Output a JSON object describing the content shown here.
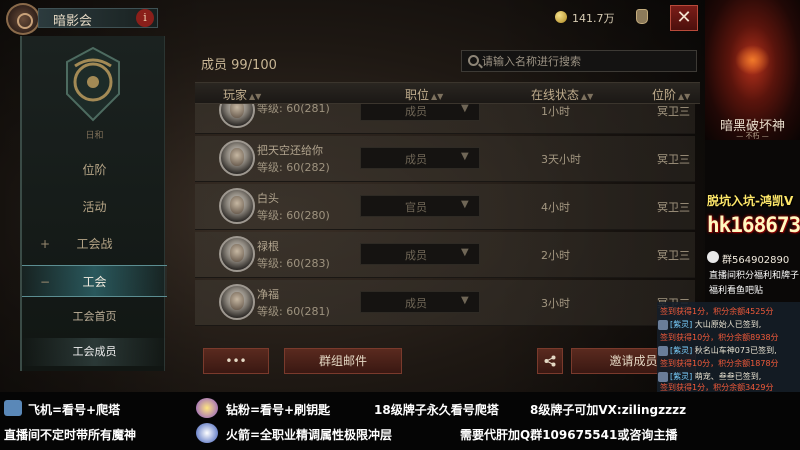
{
  "header": {
    "guild_title": "暗影会",
    "info_glyph": "i",
    "currency": "141.7万",
    "close_glyph": "✕"
  },
  "sidebar": {
    "emblem_caption": "日和",
    "items": [
      {
        "label": "位阶"
      },
      {
        "label": "活动"
      },
      {
        "label": "工会战",
        "mark": "+"
      },
      {
        "label": "工会",
        "mark": "−",
        "active": true
      }
    ],
    "subitems": [
      {
        "label": "工会首页"
      },
      {
        "label": "工会成员",
        "active": true
      }
    ]
  },
  "main": {
    "member_count": "成员 99/100",
    "search_placeholder": "请输入名称进行搜索",
    "columns": {
      "player": "玩家",
      "role": "职位",
      "status": "在线状态",
      "position": "位阶"
    },
    "sort_glyph": "▲▼",
    "rows": [
      {
        "name": "",
        "level": "等级: 60(281)",
        "role": "成员",
        "status": "1小时",
        "position": "冥卫三"
      },
      {
        "name": "把天空还给你",
        "level": "等级: 60(282)",
        "role": "成员",
        "status": "3天小时",
        "position": "冥卫三"
      },
      {
        "name": "白头",
        "level": "等级: 60(280)",
        "role": "官员",
        "status": "4小时",
        "position": "冥卫三"
      },
      {
        "name": "禄根",
        "level": "等级: 60(283)",
        "role": "成员",
        "status": "2小时",
        "position": "冥卫三"
      },
      {
        "name": "净福",
        "level": "等级: 60(281)",
        "role": "成员",
        "status": "3小时",
        "position": "冥卫三"
      }
    ],
    "dropdown_glyph": "▼",
    "buttons": {
      "more": "•••",
      "group_mail": "群组邮件",
      "invite": "邀请成员"
    }
  },
  "right_banner": {
    "logo": "暗黑破坏神",
    "logo_sub": "— 不朽 —",
    "promo_1": "脱坑入坑-鸿凯V",
    "promo_id": "hk168673",
    "qq_group": "群564902890",
    "promo_2": "直播间积分福利和牌子福利看鱼吧贴"
  },
  "chat": [
    {
      "text": "签到获得1分，积分余额4525分"
    },
    {
      "tag": "[紫灵]",
      "who": "大山原始人",
      "text": "已签到,"
    },
    {
      "text": "签到获得10分，积分余额8938分"
    },
    {
      "tag": "[紫灵]",
      "who": "秋名山车神073",
      "text": "已签到,"
    },
    {
      "text": "签到获得10分，积分余额1878分"
    },
    {
      "tag": "[紫灵]",
      "who": "萌宠、叁叁",
      "text": "已签到,"
    },
    {
      "text": "签到获得1分，积分余额3429分"
    }
  ],
  "bottom": {
    "line1a": "飞机=看号+爬塔",
    "line1b": "钻粉=看号+刷钥匙",
    "line1c": "18级牌子永久看号爬塔",
    "line1d": "8级牌子可加VX:zilingzzzz",
    "line2a": "直播间不定时带所有魔神",
    "line2b": "火箭=全职业精调属性极限冲层",
    "line2c": "需要代肝加Q群109675541或咨询主播"
  }
}
